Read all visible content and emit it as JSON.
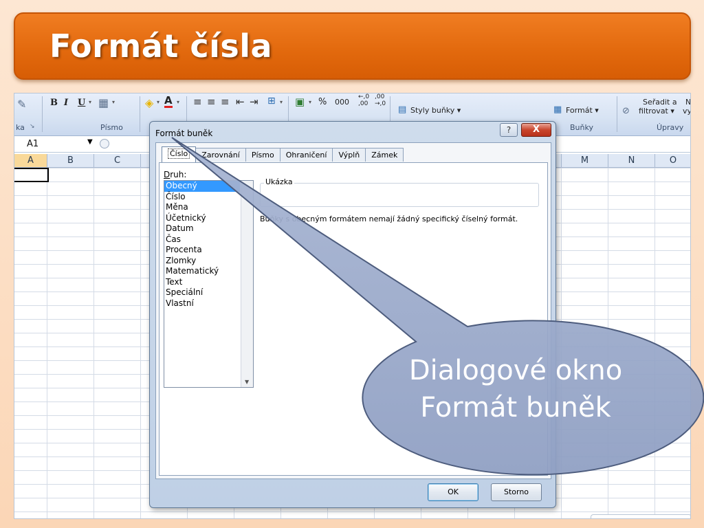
{
  "slide": {
    "title": "Formát čísla",
    "callout": [
      "Dialogové okno",
      "Formát buněk"
    ]
  },
  "ribbon": {
    "left_partial_label": "ka",
    "font_group_label": "Písmo",
    "percent_symbol": "%",
    "thousands_symbol": "000",
    "decimal_increase": "←,0\n,00",
    "decimal_decrease": ",00\n→,0",
    "styles_button": "Styly buňky ▾",
    "format_button": "Formát ▾",
    "cells_group_label": "Buňky",
    "sort_filter_line1": "Seřadit a",
    "sort_filter_line2": "filtrovat ▾",
    "edit_group_label": "Úpravy",
    "edit_partial_right": "N",
    "edit_partial_right2": "vy"
  },
  "formula_bar": {
    "name_box": "A1"
  },
  "columns": [
    "A",
    "B",
    "C",
    "",
    "",
    "",
    "",
    "",
    "",
    "",
    "",
    "",
    "M",
    "N",
    "O"
  ],
  "dialog": {
    "title": "Formát buněk",
    "help": "?",
    "close": "X",
    "tabs": [
      "Číslo",
      "Zarovnání",
      "Písmo",
      "Ohraničení",
      "Výplň",
      "Zámek"
    ],
    "category_label_prefix": "D",
    "category_label_rest": "ruh:",
    "categories": [
      "Obecný",
      "Číslo",
      "Měna",
      "Účetnický",
      "Datum",
      "Čas",
      "Procenta",
      "Zlomky",
      "Matematický",
      "Text",
      "Speciální",
      "Vlastní"
    ],
    "selected_category": "Obecný",
    "sample_label": "Ukázka",
    "description": "Buňky s obecným formátem nemají žádný specifický číselný formát.",
    "ok_button": "OK",
    "cancel_button": "Storno"
  },
  "colors": {
    "banner": "#e36a0e",
    "callout_fill": "#9aa9c9",
    "selection": "#3399ff"
  }
}
